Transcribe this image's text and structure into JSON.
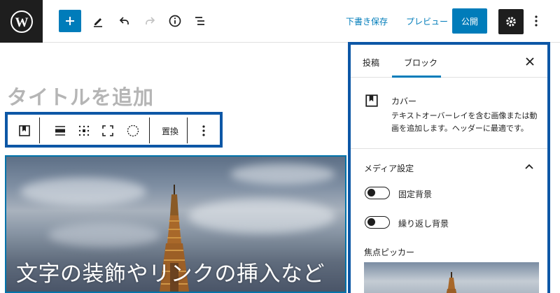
{
  "toolbar": {
    "draft_save": "下書き保存",
    "preview": "プレビュー",
    "publish": "公開"
  },
  "editor": {
    "title_placeholder": "タイトルを追加",
    "block_toolbar": {
      "replace": "置換"
    },
    "cover_text": "文字の装飾やリンクの挿入など"
  },
  "sidebar": {
    "tabs": [
      {
        "label": "投稿"
      },
      {
        "label": "ブロック"
      }
    ],
    "block_card": {
      "title": "カバー",
      "description": "テキストオーバーレイを含む画像または動画を追加します。ヘッダーに最適です。"
    },
    "media_settings": {
      "heading": "メディア設定",
      "fixed_background": "固定背景",
      "repeated_background": "繰り返し背景",
      "focal_point_picker": "焦点ピッカー"
    }
  },
  "colors": {
    "accent": "#007cba",
    "highlight": "#0d57a6",
    "dark": "#1e1e1e"
  }
}
